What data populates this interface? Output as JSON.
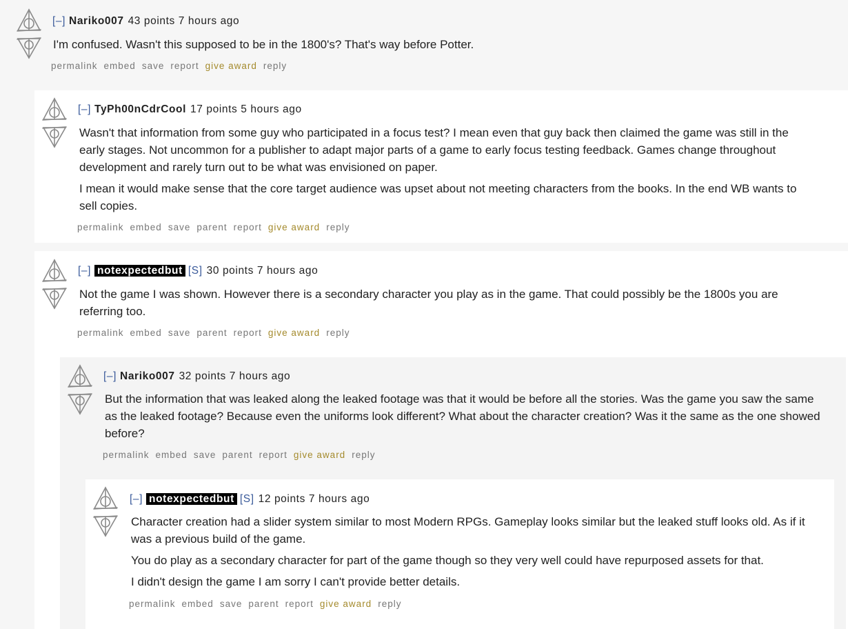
{
  "comments": [
    {
      "toggle": "[–]",
      "author": "Nariko007",
      "flair": "",
      "meta": "43 points 7 hours ago",
      "body": [
        "I'm confused. Wasn't this supposed to be in the 1800's? That's way before Potter."
      ],
      "buttons": {
        "permalink": "permalink",
        "embed": "embed",
        "save": "save",
        "parent": "",
        "report": "report",
        "give_award": "give award",
        "reply": "reply"
      }
    },
    {
      "toggle": "[–]",
      "author": "TyPh00nCdrCool",
      "flair": "",
      "meta": "17 points 5 hours ago",
      "body": [
        "Wasn't that information from some guy who participated in a focus test? I mean even that guy back then claimed the game was still in the early stages. Not uncommon for a publisher to adapt major parts of a game to early focus testing feedback. Games change throughout development and rarely turn out to be what was envisioned on paper.",
        "I mean it would make sense that the core target audience was upset about not meeting characters from the books. In the end WB wants to sell copies."
      ],
      "buttons": {
        "permalink": "permalink",
        "embed": "embed",
        "save": "save",
        "parent": "parent",
        "report": "report",
        "give_award": "give award",
        "reply": "reply"
      }
    },
    {
      "toggle": "[–]",
      "author": "notexpectedbut",
      "flair": "[S]",
      "meta": "30 points 7 hours ago",
      "body": [
        "Not the game I was shown. However there is a secondary character you play as in the game. That could possibly be the 1800s you are referring too."
      ],
      "buttons": {
        "permalink": "permalink",
        "embed": "embed",
        "save": "save",
        "parent": "parent",
        "report": "report",
        "give_award": "give award",
        "reply": "reply"
      }
    },
    {
      "toggle": "[–]",
      "author": "Nariko007",
      "flair": "",
      "meta": "32 points 7 hours ago",
      "body": [
        "But the information that was leaked along the leaked footage was that it would be before all the stories. Was the game you saw the same as the leaked footage? Because even the uniforms look different? What about the character creation? Was it the same as the one showed before?"
      ],
      "buttons": {
        "permalink": "permalink",
        "embed": "embed",
        "save": "save",
        "parent": "parent",
        "report": "report",
        "give_award": "give award",
        "reply": "reply"
      }
    },
    {
      "toggle": "[–]",
      "author": "notexpectedbut",
      "flair": "[S]",
      "meta": "12 points 7 hours ago",
      "body": [
        "Character creation had a slider system similar to most Modern RPGs. Gameplay looks similar but the leaked stuff looks old. As if it was a previous build of the game.",
        "You do play as a secondary character for part of the game though so they very well could have repurposed assets for that.",
        "I didn't design the game I am sorry I can't provide better details."
      ],
      "buttons": {
        "permalink": "permalink",
        "embed": "embed",
        "save": "save",
        "parent": "parent",
        "report": "report",
        "give_award": "give award",
        "reply": "reply"
      }
    }
  ],
  "colors": {
    "page_bg": "#f0f0f0",
    "panel_alt": "#f6f6f6",
    "panel_white": "#ffffff",
    "award": "#a48a2c",
    "toggle": "#3a5a9a"
  }
}
